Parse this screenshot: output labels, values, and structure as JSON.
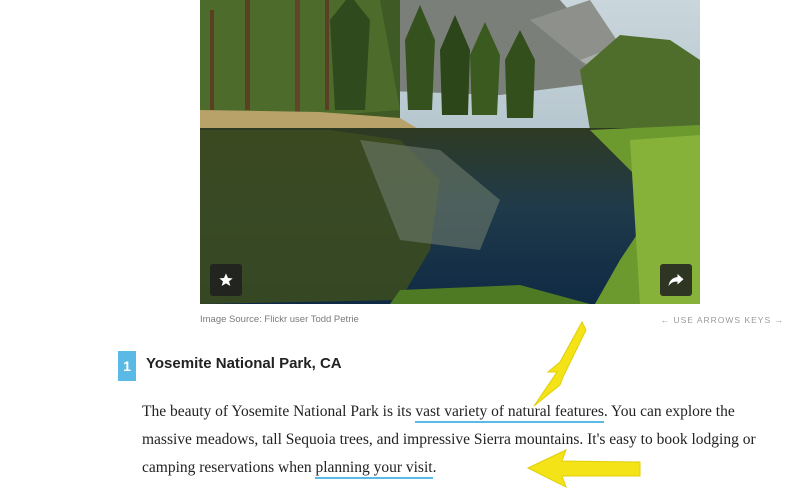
{
  "image": {
    "source_caption": "Image Source: Flickr user Todd Petrie",
    "nav_hint": "← USE ARROWS KEYS →",
    "favorite_icon": "star-icon",
    "share_icon": "share-arrow-icon"
  },
  "listing": {
    "number": "1",
    "title": "Yosemite National Park, CA",
    "paragraph": {
      "part1": "The beauty of Yosemite National Park is its ",
      "link1": "vast variety of natural features",
      "part2": ". You can explore the massive meadows, tall Sequoia trees, and impressive Sierra mountains. It's easy to book lodging or camping reservations when ",
      "link2": "planning your visit",
      "part3": "."
    }
  },
  "colors": {
    "accent": "#5bb9e5",
    "annotation_arrow": "#f3e317"
  }
}
